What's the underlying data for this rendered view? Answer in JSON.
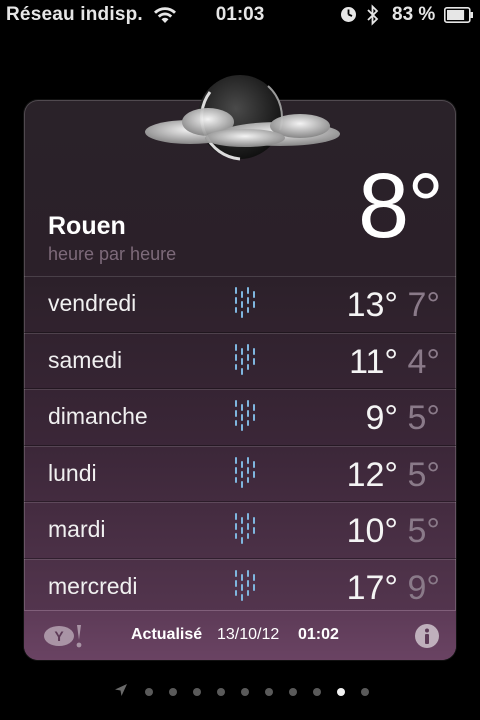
{
  "status_bar": {
    "carrier": "Réseau indisp.",
    "time": "01:03",
    "battery_percent": "83 %",
    "battery_level": 0.83,
    "icons": [
      "wifi-icon",
      "clock-lock-icon",
      "bluetooth-icon",
      "battery-icon"
    ]
  },
  "weather": {
    "city": "Rouen",
    "subtitle": "heure par heure",
    "current_temp": "8°",
    "condition_icon": "moon-cloud-icon",
    "forecast": [
      {
        "day": "vendredi",
        "high": "13°",
        "low": "7°",
        "icon": "rain-icon"
      },
      {
        "day": "samedi",
        "high": "11°",
        "low": "4°",
        "icon": "rain-icon"
      },
      {
        "day": "dimanche",
        "high": "9°",
        "low": "5°",
        "icon": "rain-icon"
      },
      {
        "day": "lundi",
        "high": "12°",
        "low": "5°",
        "icon": "rain-icon"
      },
      {
        "day": "mardi",
        "high": "10°",
        "low": "5°",
        "icon": "rain-icon"
      },
      {
        "day": "mercredi",
        "high": "17°",
        "low": "9°",
        "icon": "rain-icon"
      }
    ],
    "footer": {
      "updated_label": "Actualisé",
      "updated_date": "13/10/12",
      "updated_time": "01:02",
      "provider_icon": "yahoo-icon",
      "info_icon": "info-icon"
    }
  },
  "pager": {
    "count": 10,
    "active_index": 8
  },
  "colors": {
    "card_top": "#2a2229",
    "card_bottom": "#5a3954",
    "low_temp": "#8a7a89",
    "subtitle": "#7d6a7a"
  }
}
